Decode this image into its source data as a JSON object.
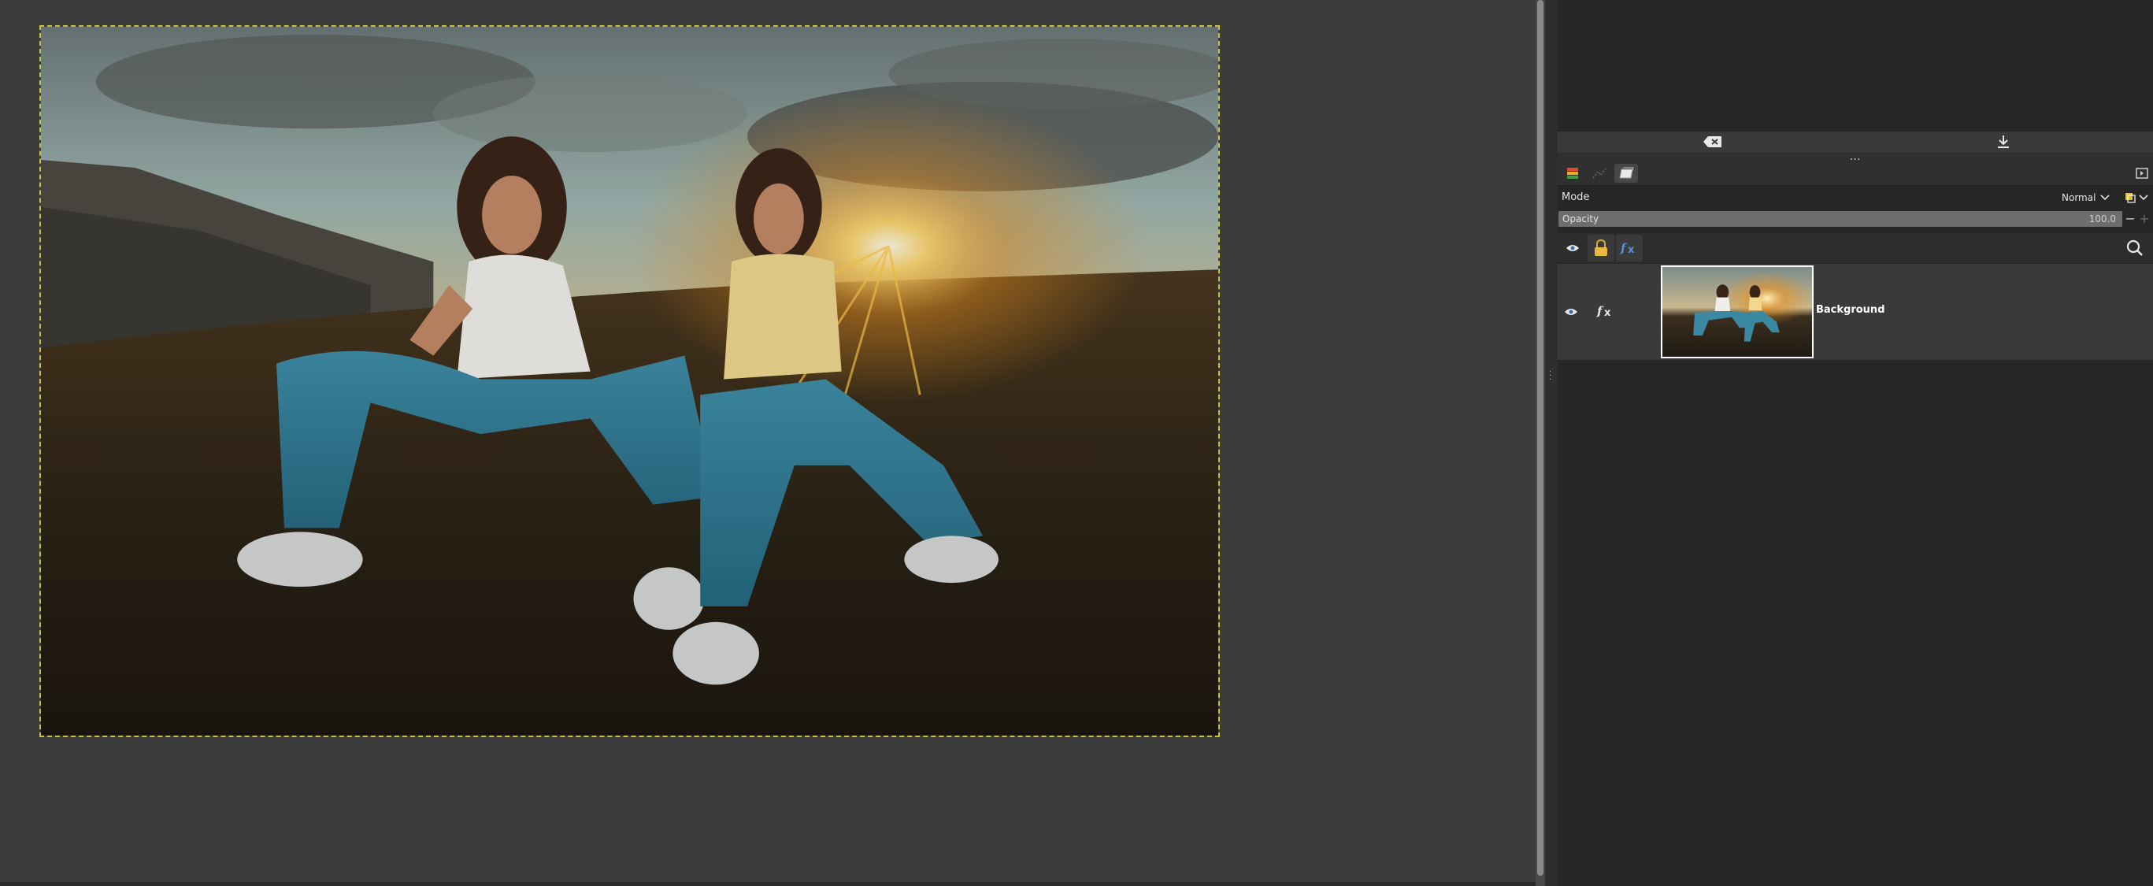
{
  "canvas": {
    "image": {
      "description_icon": "photo"
    }
  },
  "panel": {
    "toolbar": {
      "clear_icon": "backspace-x-icon",
      "download_icon": "download-icon",
      "grip": "…"
    },
    "dock_tabs": [
      {
        "icon": "layers-stack-icon",
        "active": false
      },
      {
        "icon": "paths-icon",
        "active": false
      },
      {
        "icon": "channels-icon",
        "active": true
      }
    ],
    "mode": {
      "label": "Mode",
      "value": "Normal"
    },
    "opacity": {
      "label": "Opacity",
      "value": "100.0",
      "level": 1.0,
      "minus": "−",
      "plus": "+"
    },
    "layers": [
      {
        "name": "Background",
        "visible": true
      }
    ]
  },
  "colors": {
    "background": "#3c3c3c",
    "panel": "#262626",
    "accent_yellow": "#e8c020",
    "fx_blue": "#5b8fd8"
  }
}
